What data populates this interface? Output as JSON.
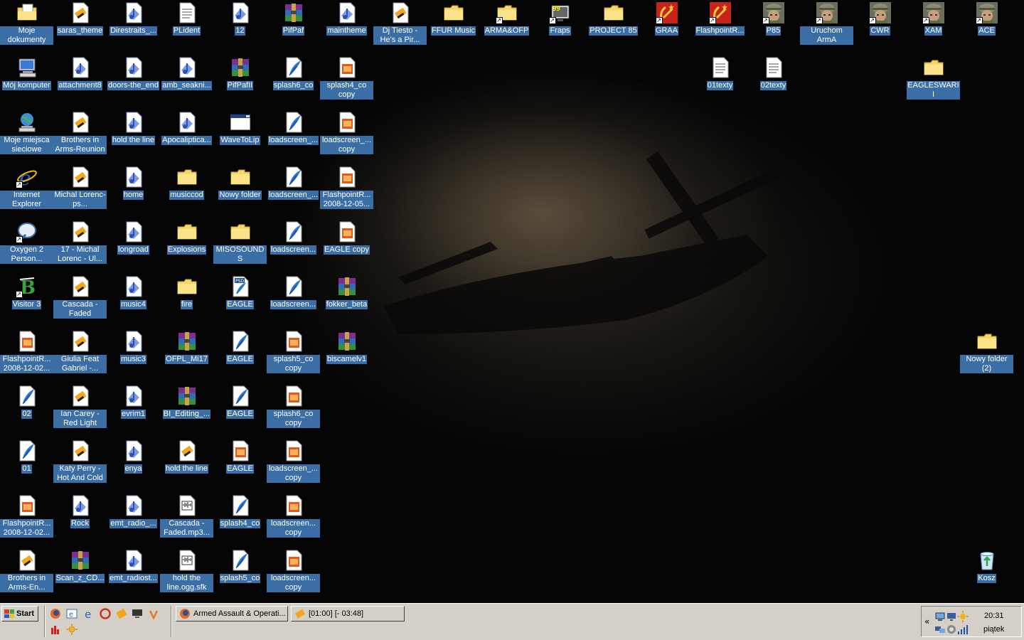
{
  "desktop": {
    "icons": [
      {
        "label": "Moje dokumenty",
        "type": "folder-docs"
      },
      {
        "label": "saras_theme",
        "type": "media"
      },
      {
        "label": "Direstraits_...",
        "type": "audio"
      },
      {
        "label": "PLident",
        "type": "text"
      },
      {
        "label": "12",
        "type": "audio"
      },
      {
        "label": "PifPaf",
        "type": "rar"
      },
      {
        "label": "maintheme",
        "type": "audio"
      },
      {
        "label": "Dj Tiesto - He's a Pir...",
        "type": "media"
      },
      {
        "label": "FFUR Music",
        "type": "folder"
      },
      {
        "label": "ARMA&OFP",
        "type": "folder-shortcut"
      },
      {
        "label": "Fraps",
        "type": "fraps"
      },
      {
        "label": "PROJECT 85",
        "type": "folder"
      },
      {
        "label": "GRAA",
        "type": "soviet"
      },
      {
        "label": "FlashpointR...",
        "type": "soviet"
      },
      {
        "label": "P85",
        "type": "soldier"
      },
      {
        "label": "Uruchom ArmA",
        "type": "soldier"
      },
      {
        "label": "CWR",
        "type": "soldier"
      },
      {
        "label": "XAM",
        "type": "soldier"
      },
      {
        "label": "ACE",
        "type": "soldier"
      },
      {
        "label": "Mój komputer",
        "type": "computer"
      },
      {
        "label": "attachment8",
        "type": "audio"
      },
      {
        "label": "doors-the_end",
        "type": "audio"
      },
      {
        "label": "amb_seakni...",
        "type": "audio"
      },
      {
        "label": "PifPafII",
        "type": "rar"
      },
      {
        "label": "splash6_co",
        "type": "feather"
      },
      {
        "label": "splash4_co copy",
        "type": "image"
      },
      {
        "label": "01texty",
        "type": "text"
      },
      {
        "label": "02texty",
        "type": "text"
      },
      {
        "label": "EAGLESWARII",
        "type": "folder"
      },
      {
        "label": "Moje miejsca sieciowe",
        "type": "network"
      },
      {
        "label": "Brothers in Arms-Reunion",
        "type": "media"
      },
      {
        "label": "hold the line",
        "type": "audio"
      },
      {
        "label": "Apocaliptica...",
        "type": "audio"
      },
      {
        "label": "WaveToLip",
        "type": "window"
      },
      {
        "label": "loadscreen_...",
        "type": "feather"
      },
      {
        "label": "loadscreen_... copy",
        "type": "image"
      },
      {
        "label": "Internet Explorer",
        "type": "ie"
      },
      {
        "label": "Michal Lorenc-ps...",
        "type": "media"
      },
      {
        "label": "home",
        "type": "audio"
      },
      {
        "label": "musiccod",
        "type": "folder"
      },
      {
        "label": "Nowy folder",
        "type": "folder"
      },
      {
        "label": "loadscreen_...",
        "type": "feather"
      },
      {
        "label": "FlashpointR... 2008-12-05...",
        "type": "image"
      },
      {
        "label": "Oxygen 2 Person...",
        "type": "oxygen"
      },
      {
        "label": "17 - Michal Lorenc - Ul...",
        "type": "media"
      },
      {
        "label": "longroad",
        "type": "audio"
      },
      {
        "label": "Explosions",
        "type": "folder"
      },
      {
        "label": "MISOSOUNDS",
        "type": "folder"
      },
      {
        "label": "loadscreen...",
        "type": "feather"
      },
      {
        "label": "EAGLE copy",
        "type": "image"
      },
      {
        "label": "Visitor 3",
        "type": "visitor"
      },
      {
        "label": "Cascada - Faded",
        "type": "media"
      },
      {
        "label": "music4",
        "type": "audio"
      },
      {
        "label": "fire",
        "type": "folder"
      },
      {
        "label": "EAGLE",
        "type": "psd"
      },
      {
        "label": "loadscreen...",
        "type": "feather"
      },
      {
        "label": "fokker_beta",
        "type": "rar"
      },
      {
        "label": "FlashpointR... 2008-12-02...",
        "type": "image"
      },
      {
        "label": "Giulia Feat Gabriel -...",
        "type": "media"
      },
      {
        "label": "music3",
        "type": "audio"
      },
      {
        "label": "OFPL_Mi17",
        "type": "rar"
      },
      {
        "label": "EAGLE",
        "type": "feather"
      },
      {
        "label": "splash5_co copy",
        "type": "image"
      },
      {
        "label": "biscamelv1",
        "type": "rar"
      },
      {
        "label": "Nowy folder (2)",
        "type": "folder"
      },
      {
        "label": "02",
        "type": "feather"
      },
      {
        "label": "Ian Carey - Red Light",
        "type": "media"
      },
      {
        "label": "evrim1",
        "type": "audio"
      },
      {
        "label": "BI_Editing_...",
        "type": "rar"
      },
      {
        "label": "EAGLE",
        "type": "feather"
      },
      {
        "label": "splash6_co copy",
        "type": "image"
      },
      {
        "label": "01",
        "type": "feather"
      },
      {
        "label": "Katy Perry - Hot And Cold",
        "type": "media"
      },
      {
        "label": "enya",
        "type": "audio"
      },
      {
        "label": "hold the line",
        "type": "media"
      },
      {
        "label": "EAGLE",
        "type": "image"
      },
      {
        "label": "loadscreen_... copy",
        "type": "image"
      },
      {
        "label": "FlashpointR... 2008-12-02...",
        "type": "image"
      },
      {
        "label": "Rock",
        "type": "audio"
      },
      {
        "label": "emt_radio_...",
        "type": "audio"
      },
      {
        "label": "Cascada - Faded.mp3...",
        "type": "sfk"
      },
      {
        "label": "splash4_co",
        "type": "feather"
      },
      {
        "label": "loadscreen... copy",
        "type": "image"
      },
      {
        "label": "Brothers in Arms-En...",
        "type": "media"
      },
      {
        "label": "Scan_z_CD...",
        "type": "rar"
      },
      {
        "label": "emt_radiost...",
        "type": "audio"
      },
      {
        "label": "hold the line.ogg.sfk",
        "type": "sfk"
      },
      {
        "label": "splash5_co",
        "type": "feather"
      },
      {
        "label": "loadscreen... copy",
        "type": "image"
      },
      {
        "label": "Kosz",
        "type": "recycle"
      }
    ]
  },
  "taskbar": {
    "start_label": "Start",
    "quick_launch": [
      "firefox-icon",
      "ie-icon",
      "ie-blue-icon",
      "opera-icon",
      "media-icon",
      "monitor-icon",
      "winamp-icon",
      "chart-icon",
      "sun-icon"
    ],
    "tasks": [
      {
        "label": "Armed Assault & Operati...",
        "icon": "firefox-icon"
      },
      {
        "label": "[01:00] [- 03:48]",
        "icon": "player-icon"
      }
    ],
    "tray": {
      "chevron": "«",
      "time": "20:31",
      "day": "piątek"
    }
  },
  "colors": {
    "label_bg": "#3a6ea5",
    "taskbar_bg": "#d4d0c8",
    "desktop_bg": "#040404"
  }
}
